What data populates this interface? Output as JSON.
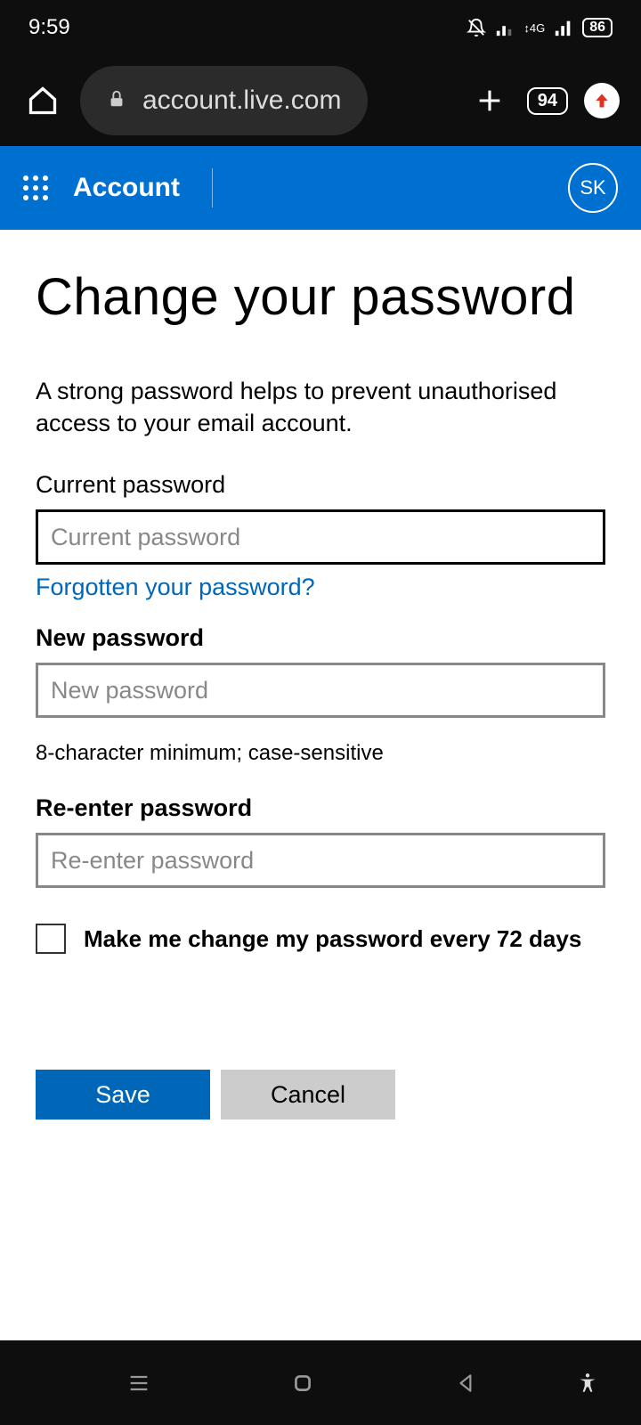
{
  "status": {
    "time": "9:59",
    "network": "4G",
    "battery": "86"
  },
  "browser": {
    "url": "account.live.com",
    "tab_count": "94"
  },
  "ms_header": {
    "title": "Account",
    "avatar": "SK"
  },
  "page": {
    "title": "Change your password",
    "description": "A strong password helps to prevent unauthorised access to your email account.",
    "current_label": "Current password",
    "current_placeholder": "Current password",
    "forgot_link": "Forgotten your password?",
    "new_label": "New password",
    "new_placeholder": "New password",
    "new_hint": "8-character minimum; case-sensitive",
    "reenter_label": "Re-enter password",
    "reenter_placeholder": "Re-enter password",
    "checkbox_label": "Make me change my password every 72 days",
    "save_label": "Save",
    "cancel_label": "Cancel"
  }
}
